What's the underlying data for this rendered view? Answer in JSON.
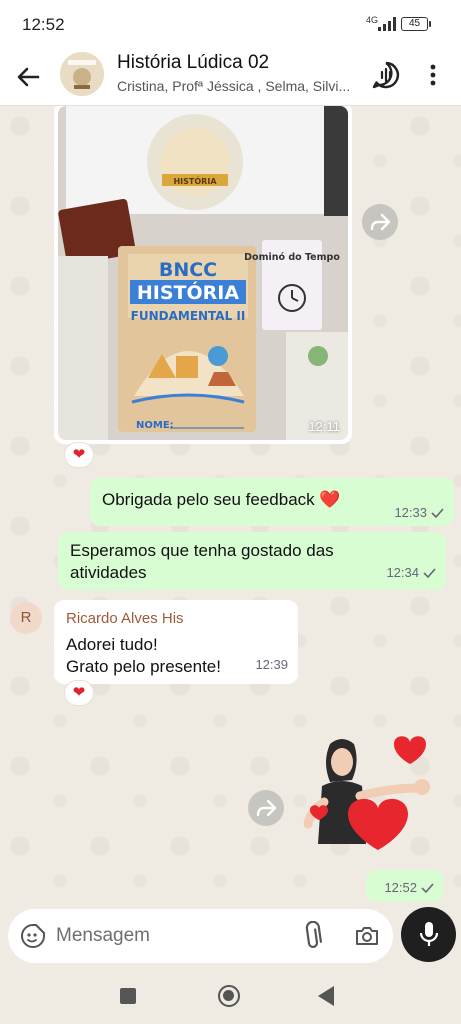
{
  "status_bar": {
    "time": "12:52",
    "network": "4G",
    "battery": "45"
  },
  "header": {
    "title": "História Lúdica 02",
    "subtitle": "Cristina, Profª Jéssica , Selma, Silvi..."
  },
  "messages": {
    "image": {
      "time": "12:11",
      "reaction": "❤",
      "photo_text": {
        "book_line1": "BNCC",
        "book_line2": "HISTÓRIA",
        "book_line3": "FUNDAMENTAL II",
        "book_name": "NOME:",
        "box_title": "Dominó do Tempo",
        "logo_text": "HISTÓRIA"
      }
    },
    "out1": {
      "text": "Obrigada pelo seu feedback ❤️",
      "time": "12:33"
    },
    "out2": {
      "text": "Esperamos que tenha gostado das atividades",
      "time": "12:34"
    },
    "in1": {
      "sender": "Ricardo Alves His",
      "avatar_letter": "R",
      "line1": "Adorei tudo!",
      "line2": "Grato pelo presente!",
      "time": "12:39",
      "reaction": "❤"
    },
    "sticker": {
      "time": "12:52"
    }
  },
  "composer": {
    "placeholder": "Mensagem"
  },
  "colors": {
    "outgoing": "#d9fdd3",
    "incoming": "#ffffff",
    "wallpaper": "#efeae2",
    "sender": "#a05a38"
  }
}
